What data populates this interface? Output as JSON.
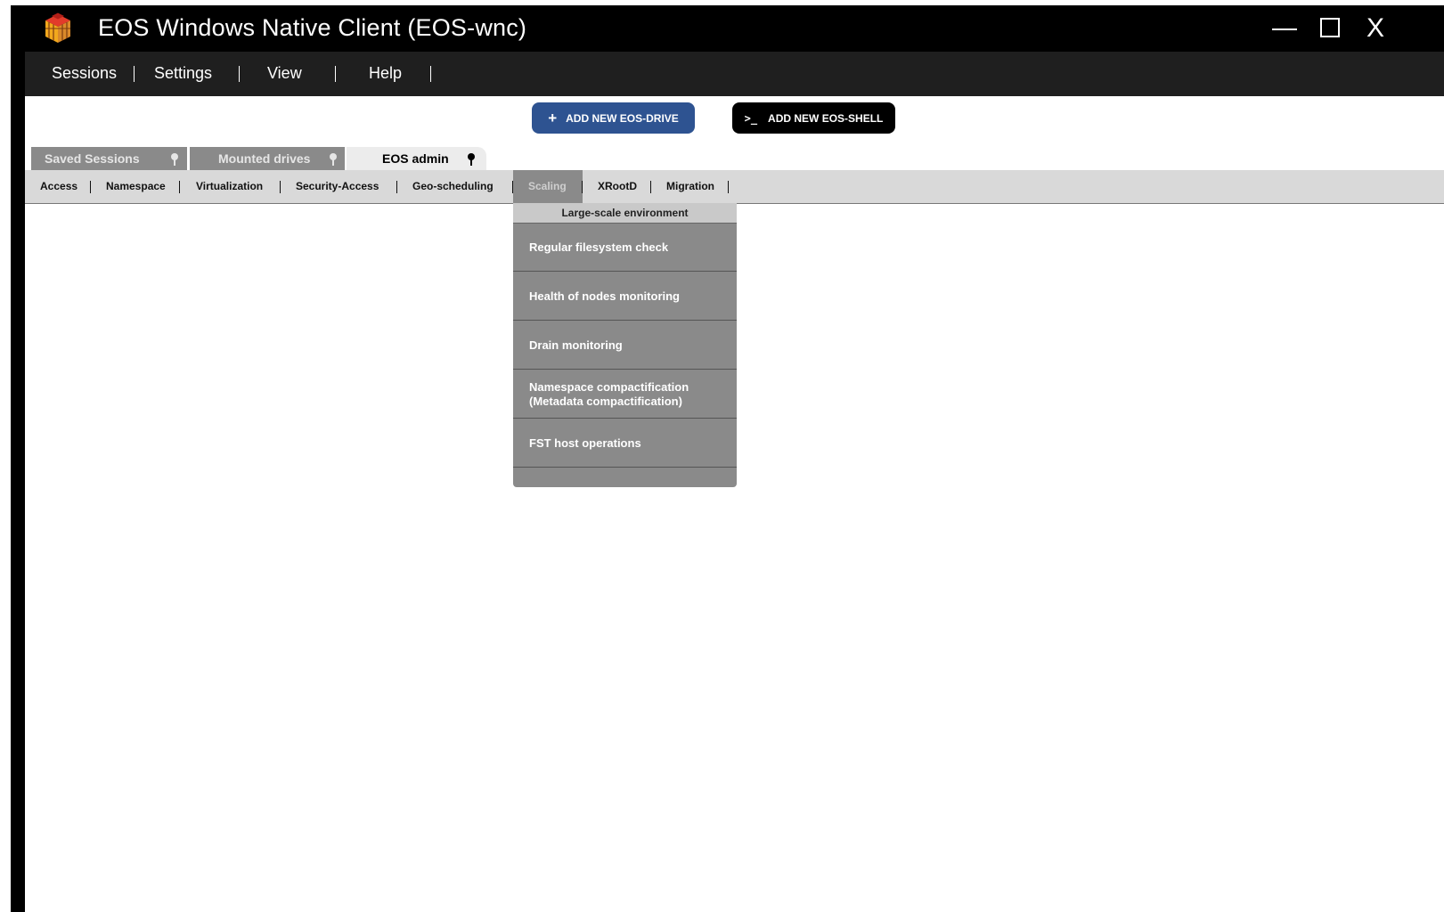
{
  "window": {
    "title": "EOS Windows Native Client (EOS-wnc)",
    "close_label": "X"
  },
  "menubar": {
    "items": [
      "Sessions",
      "Settings",
      "View",
      "Help"
    ]
  },
  "toolbar": {
    "add_drive": "ADD NEW EOS-DRIVE",
    "add_drive_icon": "+",
    "add_shell": "ADD NEW EOS-SHELL",
    "add_shell_icon": ">_"
  },
  "tabs": [
    {
      "label": "Saved Sessions",
      "active": false
    },
    {
      "label": "Mounted drives",
      "active": false
    },
    {
      "label": "EOS admin",
      "active": true
    }
  ],
  "subnav": {
    "items": [
      "Access",
      "Namespace",
      "Virtualization",
      "Security-Access",
      "Geo-scheduling",
      "Scaling",
      "XRootD",
      "Migration"
    ],
    "active": "Scaling"
  },
  "dropdown": {
    "header": "Large-scale environment",
    "items": [
      "Regular filesystem check",
      "Health of nodes monitoring",
      "Drain monitoring",
      "Namespace compactification (Metadata compactification)",
      "FST host operations"
    ]
  },
  "colors": {
    "accent_blue": "#2e5391",
    "tab_inactive": "#8a8a8a",
    "dropdown_bg": "#8a8a8a"
  }
}
